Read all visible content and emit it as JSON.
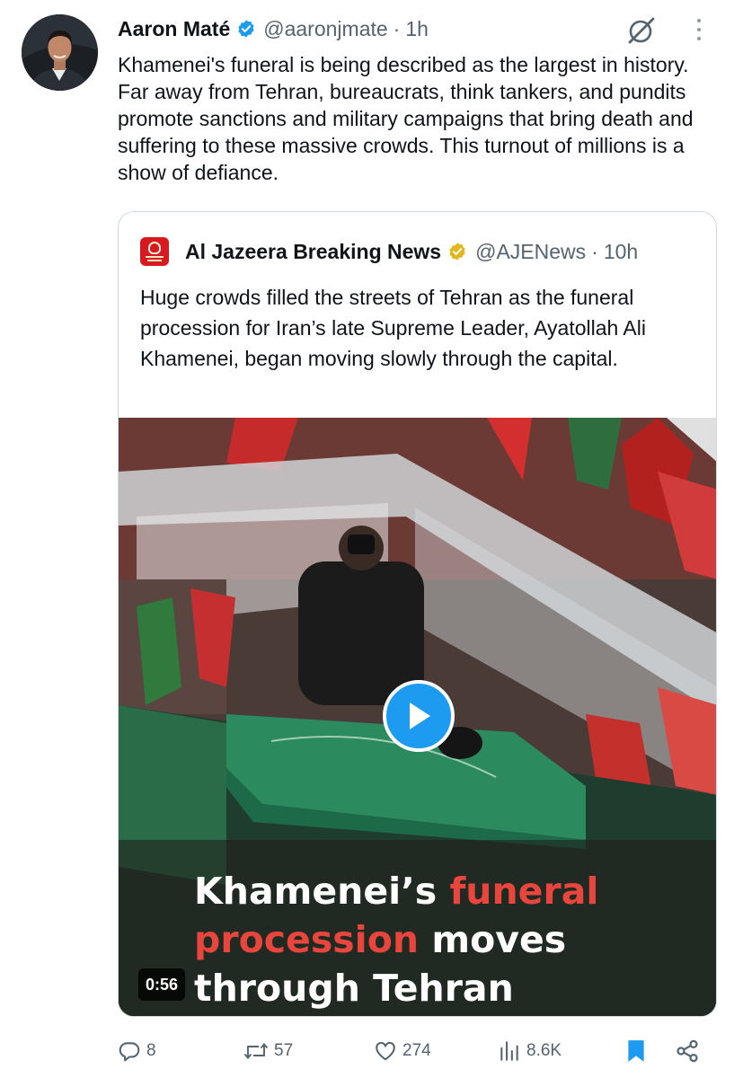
{
  "tweet": {
    "author_name": "Aaron Maté",
    "handle": "@aaronjmate",
    "separator": "·",
    "time": "1h",
    "text": "Khamenei's funeral is being described as the largest in history. Far away from Tehran, bureaucrats, think tankers, and pundits promote sanctions and military campaigns that bring death and suffering to these massive crowds. This turnout of millions is a show of defiance."
  },
  "quote": {
    "author_name": "Al Jazeera Breaking News",
    "handle": "@AJENews",
    "separator": "·",
    "time": "10h",
    "text": "Huge crowds filled the streets of Tehran as the funeral procession for Iran’s late Supreme Leader, Ayatollah Ali Khamenei, began moving slowly through the capital.",
    "video": {
      "caption_part1": "Khamenei’s ",
      "caption_part2": "funeral",
      "caption_part3": "procession",
      "caption_part4": " moves",
      "caption_part5": "through Tehran",
      "duration": "0:56"
    }
  },
  "actions": {
    "replies": "8",
    "reposts": "57",
    "likes": "274",
    "views": "8.6K"
  },
  "icons": {
    "verified": "verified-badge-icon",
    "org_verified": "gold-verified-badge-icon",
    "grok": "grok-icon",
    "more": "more-icon",
    "reply": "reply-icon",
    "repost": "repost-icon",
    "like": "heart-icon",
    "views": "views-icon",
    "bookmark": "bookmark-icon",
    "share": "share-icon"
  },
  "colors": {
    "accent": "#1d9bf0",
    "text": "#0f1419",
    "secondary": "#536471",
    "gold_badge": "#e2b719",
    "caption_red": "#e8453c"
  }
}
